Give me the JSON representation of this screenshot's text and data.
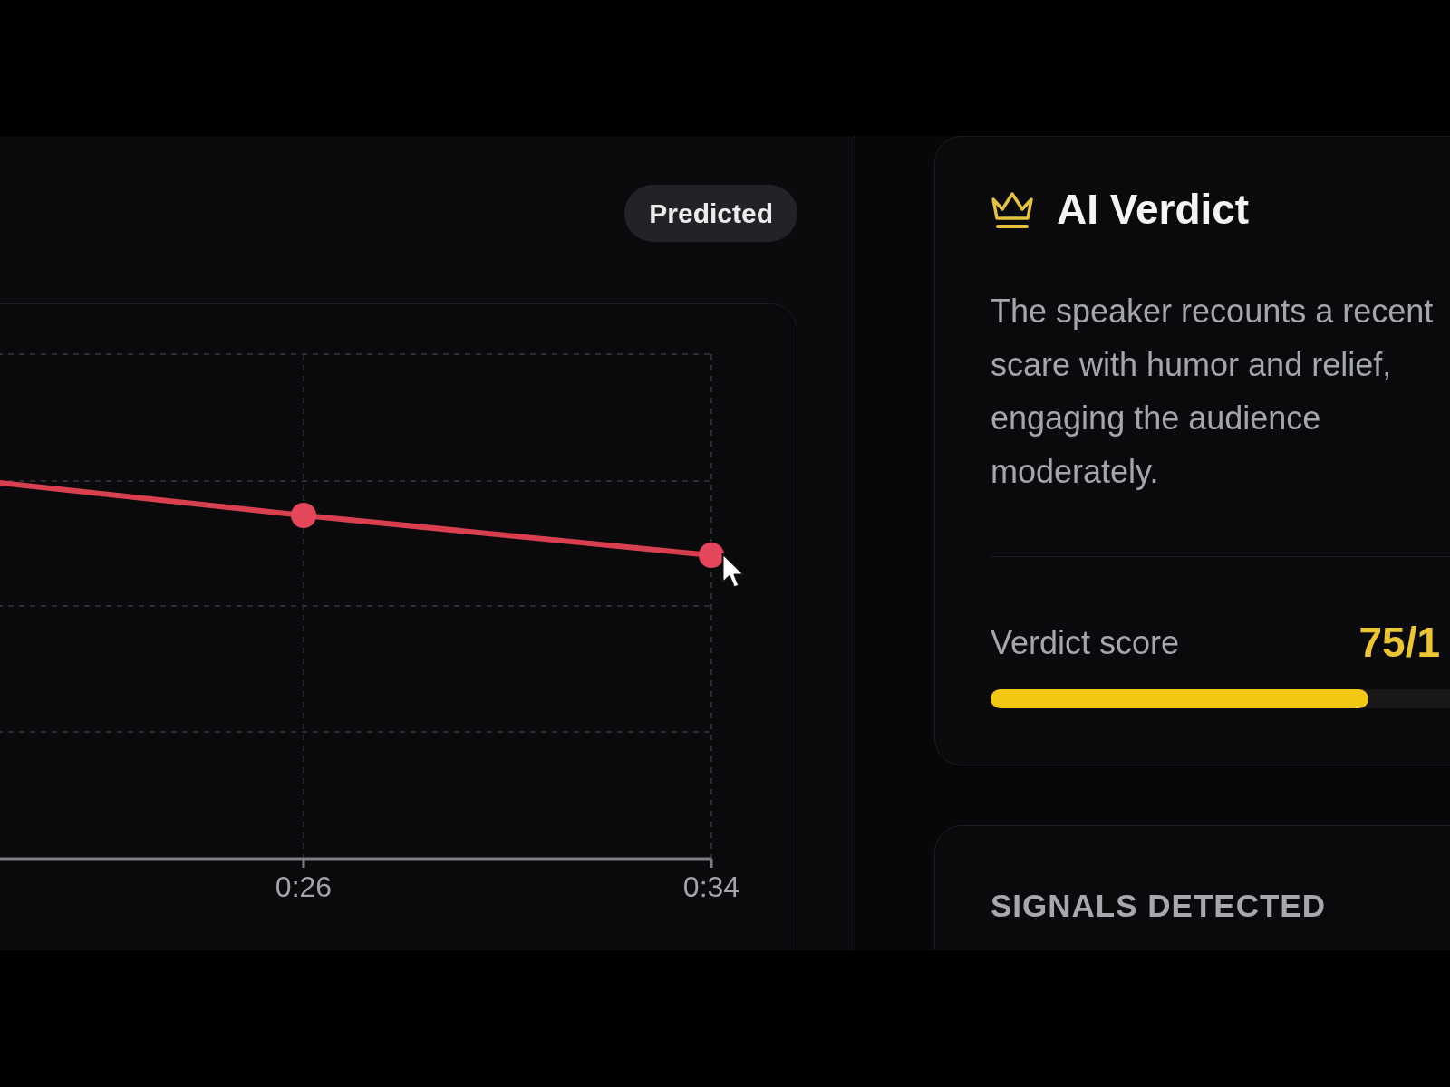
{
  "chart_panel": {
    "badge": "Predicted",
    "chart": {
      "x_tick_labels": [
        "0:26",
        "0:34"
      ]
    }
  },
  "verdict_card": {
    "title": "AI Verdict",
    "summary": "The speaker recounts a recent scare with humor and relief, engaging the audience moderately.",
    "score_label": "Verdict score",
    "score": "75/1",
    "level": 0.75
  },
  "signals_card": {
    "title": "SIGNALS DETECTED"
  }
}
